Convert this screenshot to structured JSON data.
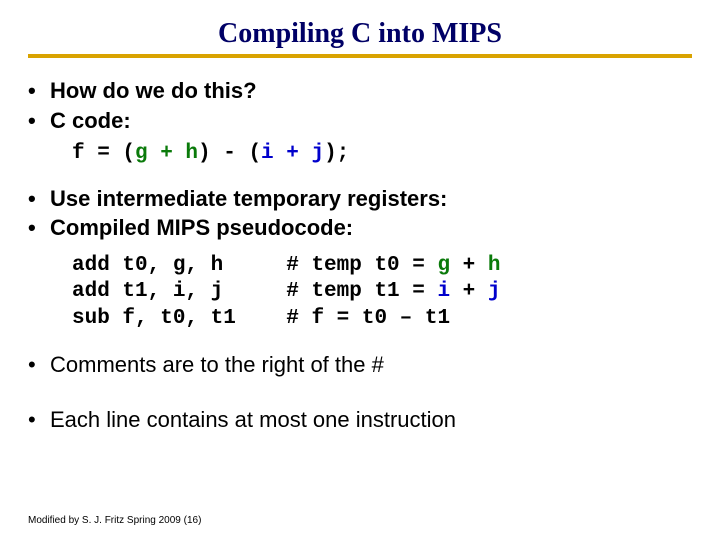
{
  "title": "Compiling C into MIPS",
  "bullets": {
    "b1": "How do we do this?",
    "b2": "C code:",
    "b3": "Use intermediate temporary registers:",
    "b4": "Compiled MIPS pseudocode:",
    "b5": "Comments are to the right of the #",
    "b6": "Each line contains at most one instruction"
  },
  "code1": {
    "p1": "f = (",
    "gh": "g + h",
    "p2": ") - (",
    "ij": "i + j",
    "p3": ");"
  },
  "code2": {
    "l1a": "add t0, g, h     # temp t0 = ",
    "l1g": "g",
    "l1p": " + ",
    "l1h": "h",
    "l2a": "add t1, i, j     # temp t1 = ",
    "l2i": "i",
    "l2p": " + ",
    "l2j": "j",
    "l3": "sub f, t0, t1    # f = t0 – t1"
  },
  "footer": "Modified by S. J. Fritz  Spring 2009 (16)"
}
